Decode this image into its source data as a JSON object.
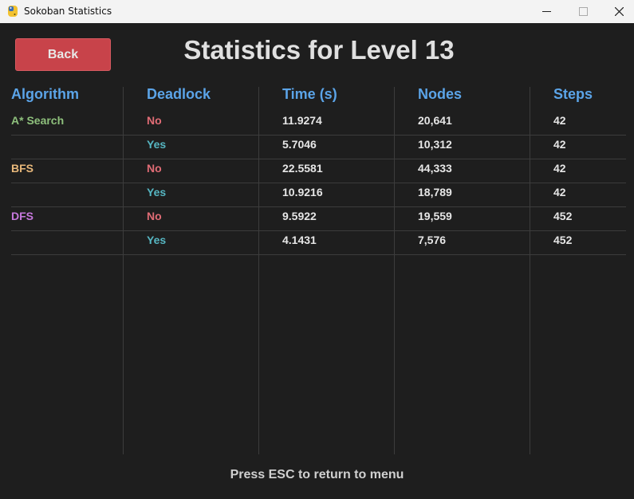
{
  "window": {
    "title": "Sokoban Statistics",
    "app_icon": "python-icon",
    "controls": [
      "minimize-icon",
      "maximize-icon",
      "close-icon"
    ]
  },
  "back_button": {
    "label": "Back"
  },
  "page_title": "Statistics for Level 13",
  "table": {
    "headers": [
      "Algorithm",
      "Deadlock",
      "Time (s)",
      "Nodes",
      "Steps"
    ],
    "rows": [
      {
        "algorithm": "A* Search",
        "deadlock": "No",
        "time": "11.9274",
        "nodes": "20,641",
        "steps": "42"
      },
      {
        "algorithm": "",
        "deadlock": "Yes",
        "time": "5.7046",
        "nodes": "10,312",
        "steps": "42"
      },
      {
        "algorithm": "BFS",
        "deadlock": "No",
        "time": "22.5581",
        "nodes": "44,333",
        "steps": "42"
      },
      {
        "algorithm": "",
        "deadlock": "Yes",
        "time": "10.9216",
        "nodes": "18,789",
        "steps": "42"
      },
      {
        "algorithm": "DFS",
        "deadlock": "No",
        "time": "9.5922",
        "nodes": "19,559",
        "steps": "452"
      },
      {
        "algorithm": "",
        "deadlock": "Yes",
        "time": "4.1431",
        "nodes": "7,576",
        "steps": "452"
      }
    ]
  },
  "footer": "Press ESC to return to menu",
  "colors": {
    "background": "#1e1e1e",
    "header": "#5ba4e8",
    "back_button": "#c8434a",
    "astar": "#8ec07c",
    "bfs": "#e8b87a",
    "dfs": "#c678dd",
    "deadlock_no": "#e06c75",
    "deadlock_yes": "#56b6c2",
    "value": "#e6e6e6"
  }
}
